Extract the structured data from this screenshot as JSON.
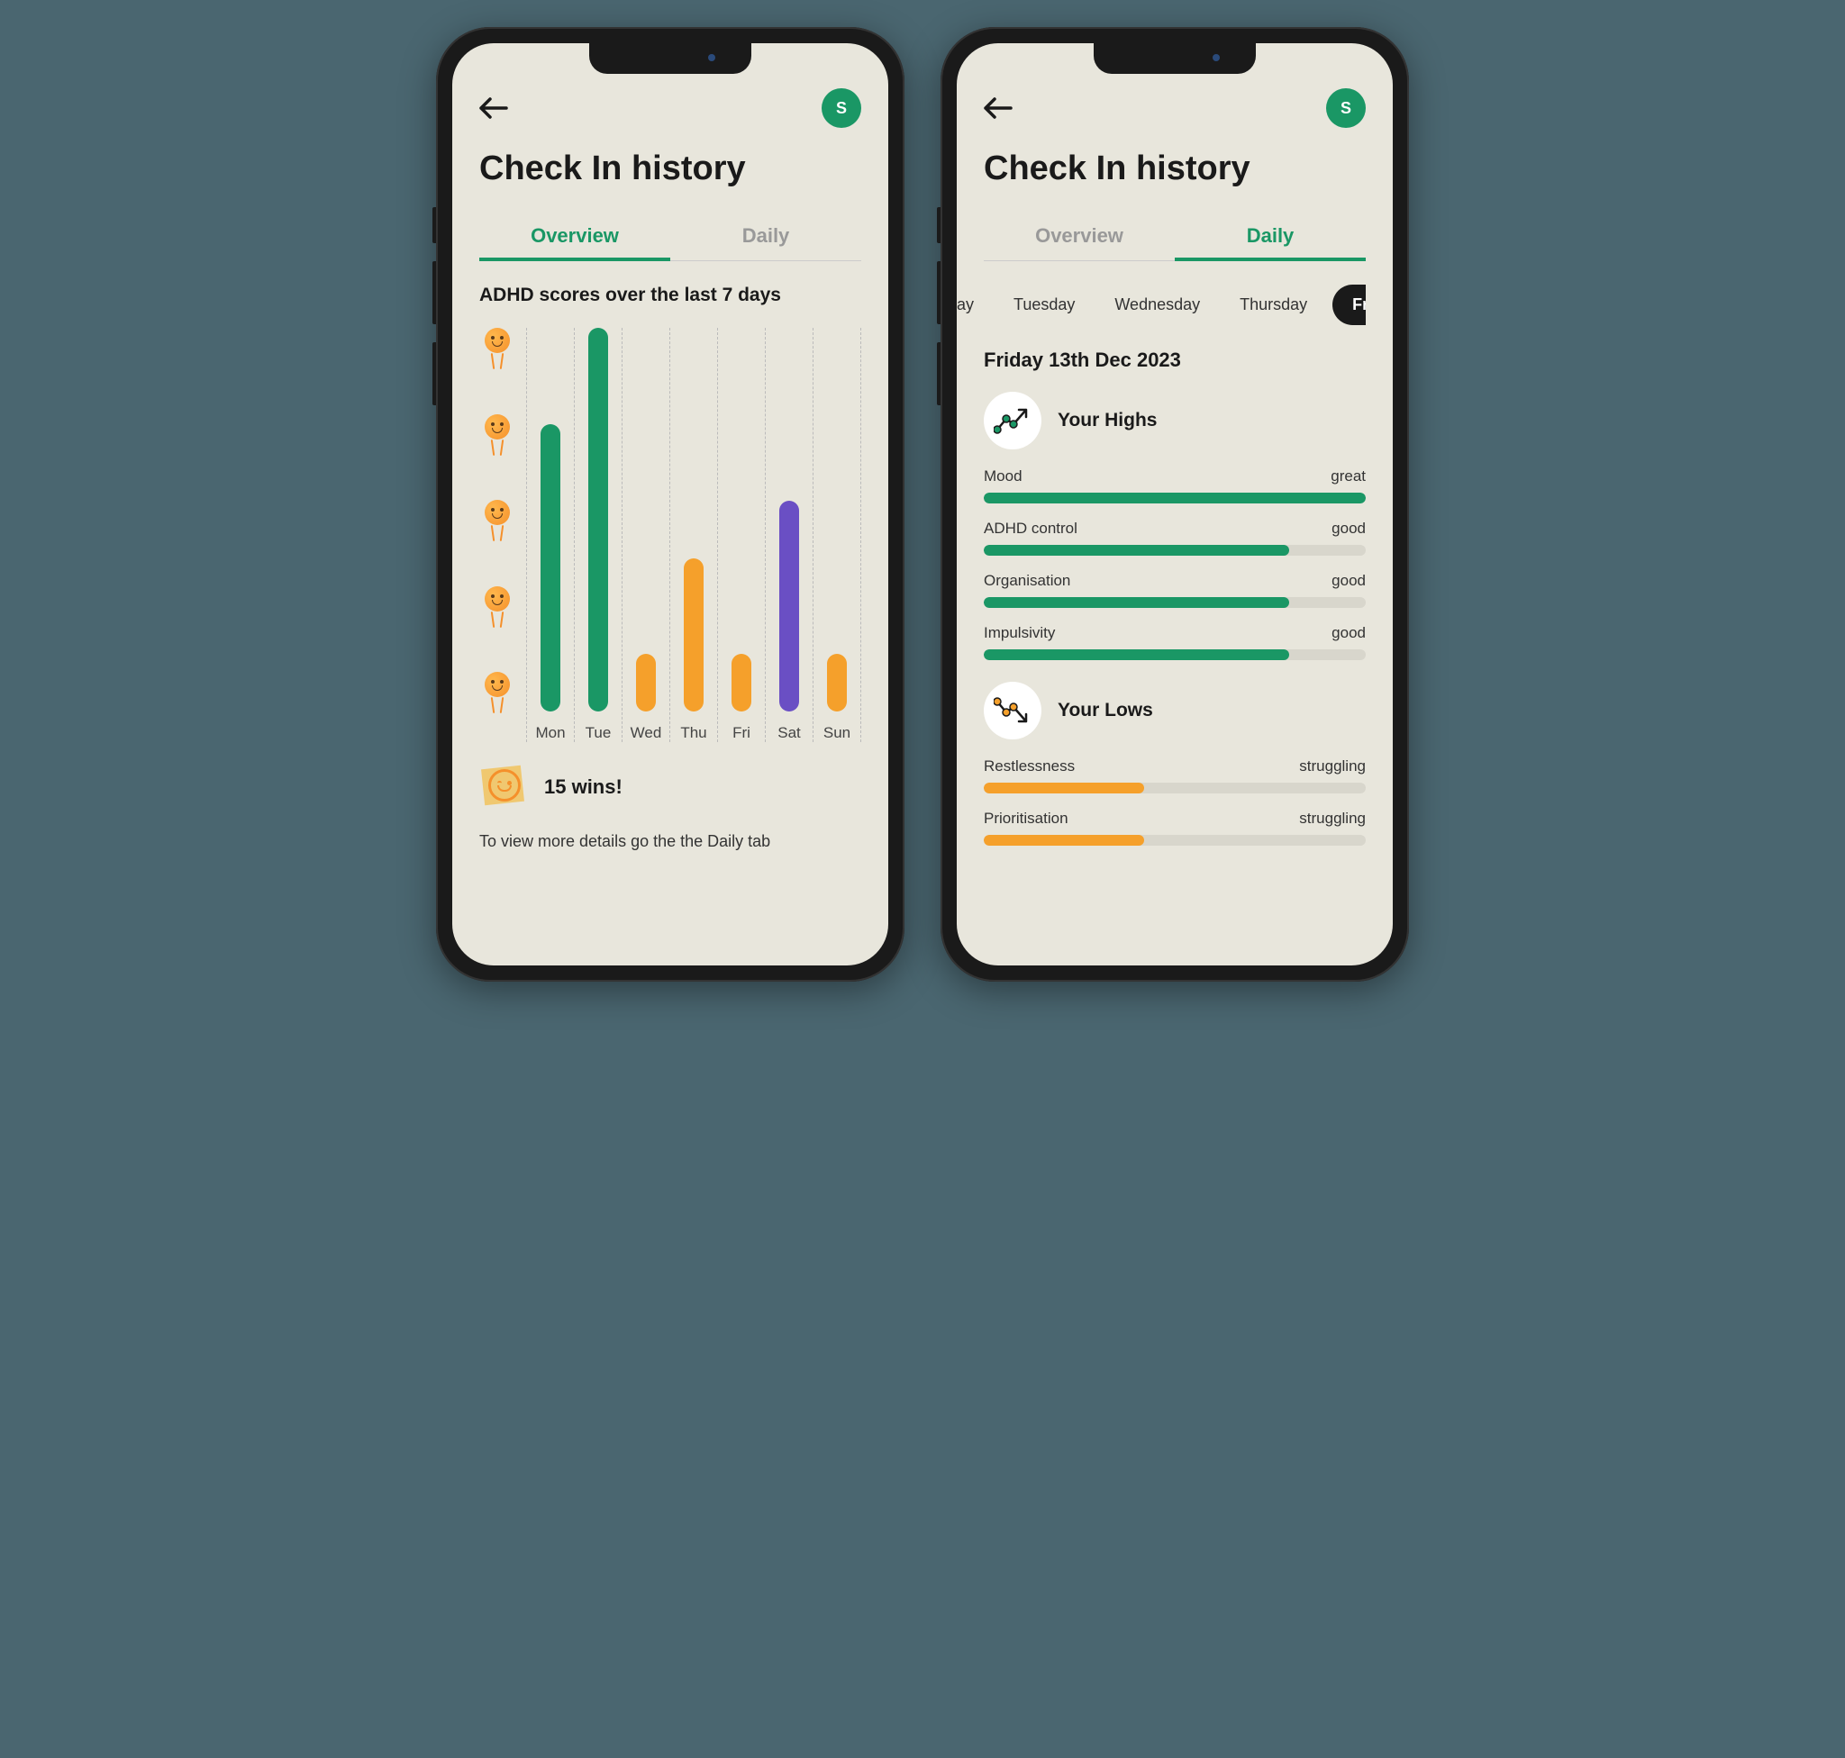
{
  "colors": {
    "green": "#1a9765",
    "orange": "#f5a02b",
    "purple": "#6a4fc4"
  },
  "avatar_initial": "S",
  "page_title": "Check In history",
  "tabs": {
    "overview": "Overview",
    "daily": "Daily"
  },
  "overview": {
    "section_title": "ADHD scores over the last 7 days",
    "wins": "15 wins!",
    "hint": "To view more details go the the Daily tab"
  },
  "chart_data": {
    "type": "bar",
    "categories": [
      "Mon",
      "Tue",
      "Wed",
      "Thu",
      "Fri",
      "Sat",
      "Sun"
    ],
    "values": [
      75,
      100,
      15,
      40,
      15,
      55,
      15
    ],
    "colors": [
      "green",
      "green",
      "orange",
      "orange",
      "orange",
      "purple",
      "orange"
    ],
    "ylim": [
      0,
      100
    ],
    "y_icons": 5,
    "title": "ADHD scores over the last 7 days",
    "xlabel": "",
    "ylabel": ""
  },
  "daily": {
    "days": [
      "ay",
      "Tuesday",
      "Wednesday",
      "Thursday",
      "Friday"
    ],
    "active_day_index": 4,
    "date": "Friday 13th Dec 2023",
    "highs_label": "Your Highs",
    "lows_label": "Your Lows",
    "highs": [
      {
        "name": "Mood",
        "value": "great",
        "pct": 100
      },
      {
        "name": "ADHD control",
        "value": "good",
        "pct": 80
      },
      {
        "name": "Organisation",
        "value": "good",
        "pct": 80
      },
      {
        "name": "Impulsivity",
        "value": "good",
        "pct": 80
      }
    ],
    "lows": [
      {
        "name": "Restlessness",
        "value": "struggling",
        "pct": 42
      },
      {
        "name": "Prioritisation",
        "value": "struggling",
        "pct": 42
      }
    ]
  }
}
